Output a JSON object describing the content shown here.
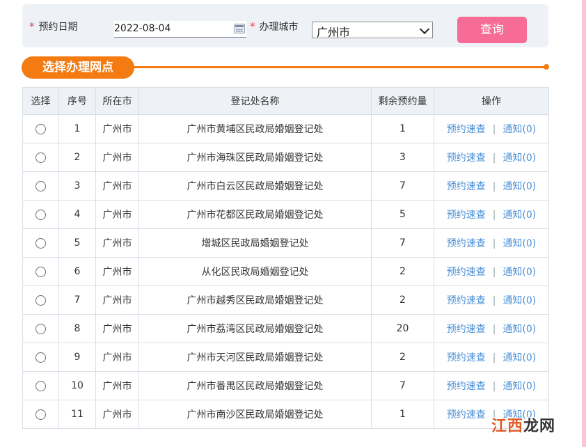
{
  "search": {
    "date_label": "预约日期",
    "date_value": "2022-08-04",
    "city_label": "办理城市",
    "city_value": "广州市",
    "query_button": "查询",
    "required_mark": "*"
  },
  "section": {
    "title": "选择办理网点"
  },
  "table": {
    "headers": [
      "选择",
      "序号",
      "所在市",
      "登记处名称",
      "剩余预约量",
      "操作"
    ],
    "rows": [
      {
        "index": "1",
        "city": "广州市",
        "name": "广州市黄埔区民政局婚姻登记处",
        "remaining": "1"
      },
      {
        "index": "2",
        "city": "广州市",
        "name": "广州市海珠区民政局婚姻登记处",
        "remaining": "3"
      },
      {
        "index": "3",
        "city": "广州市",
        "name": "广州市白云区民政局婚姻登记处",
        "remaining": "7"
      },
      {
        "index": "4",
        "city": "广州市",
        "name": "广州市花都区民政局婚姻登记处",
        "remaining": "5"
      },
      {
        "index": "5",
        "city": "广州市",
        "name": "增城区民政局婚姻登记处",
        "remaining": "7"
      },
      {
        "index": "6",
        "city": "广州市",
        "name": "从化区民政局婚姻登记处",
        "remaining": "2"
      },
      {
        "index": "7",
        "city": "广州市",
        "name": "广州市越秀区民政局婚姻登记处",
        "remaining": "2"
      },
      {
        "index": "8",
        "city": "广州市",
        "name": "广州市荔湾区民政局婚姻登记处",
        "remaining": "20"
      },
      {
        "index": "9",
        "city": "广州市",
        "name": "广州市天河区民政局婚姻登记处",
        "remaining": "2"
      },
      {
        "index": "10",
        "city": "广州市",
        "name": "广州市番禺区民政局婚姻登记处",
        "remaining": "7"
      },
      {
        "index": "11",
        "city": "广州市",
        "name": "广州市南沙区民政局婚姻登记处",
        "remaining": "1"
      }
    ],
    "op_book": "预约速查",
    "op_separator": "|",
    "op_notify": "通知(0)"
  },
  "watermark": {
    "text_main": "江西",
    "text_tail": "龙网"
  },
  "colors": {
    "accent_pink": "#f76b97",
    "section_orange": "#f37b12",
    "link_blue": "#4a8fd6",
    "count_green": "#1c8a2d",
    "required_red": "#e8424b"
  }
}
